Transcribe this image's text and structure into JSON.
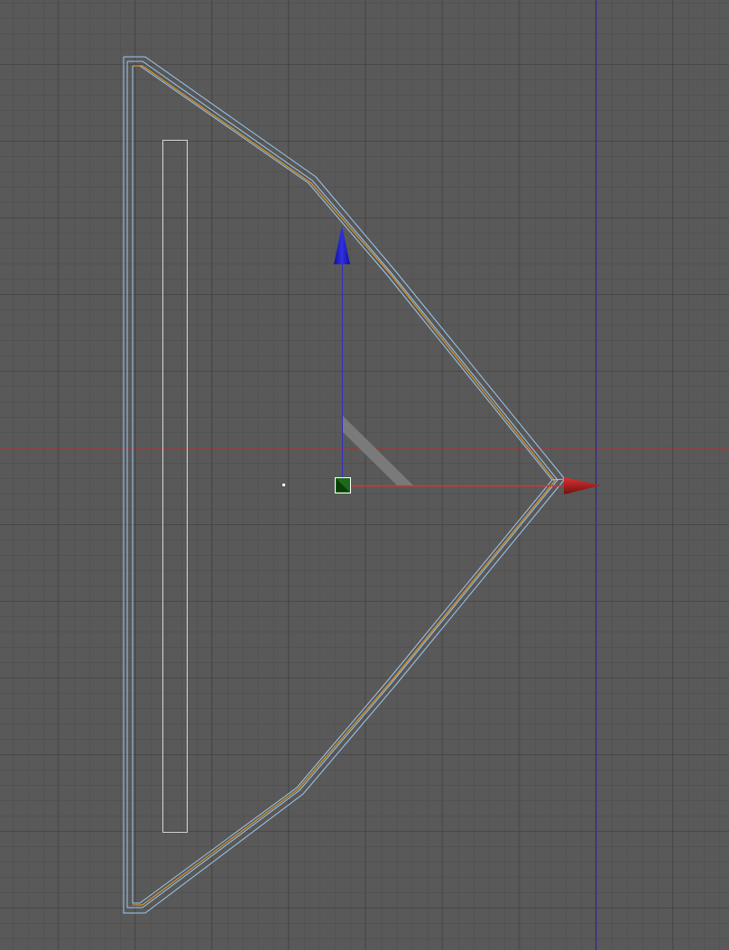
{
  "viewport": {
    "view": "top",
    "colors": {
      "background": "#595959",
      "grid_minor": "#4a4a4a",
      "grid_major": "#3c3c3c",
      "axis_x": "#c0272d",
      "axis_z": "#2424b4",
      "spline_selected": "#9cc8f0",
      "spline_orange": "#f0a020",
      "gizmo_y": "#2020c8",
      "gizmo_x": "#c01818",
      "handle": "#1a6a1a"
    }
  }
}
